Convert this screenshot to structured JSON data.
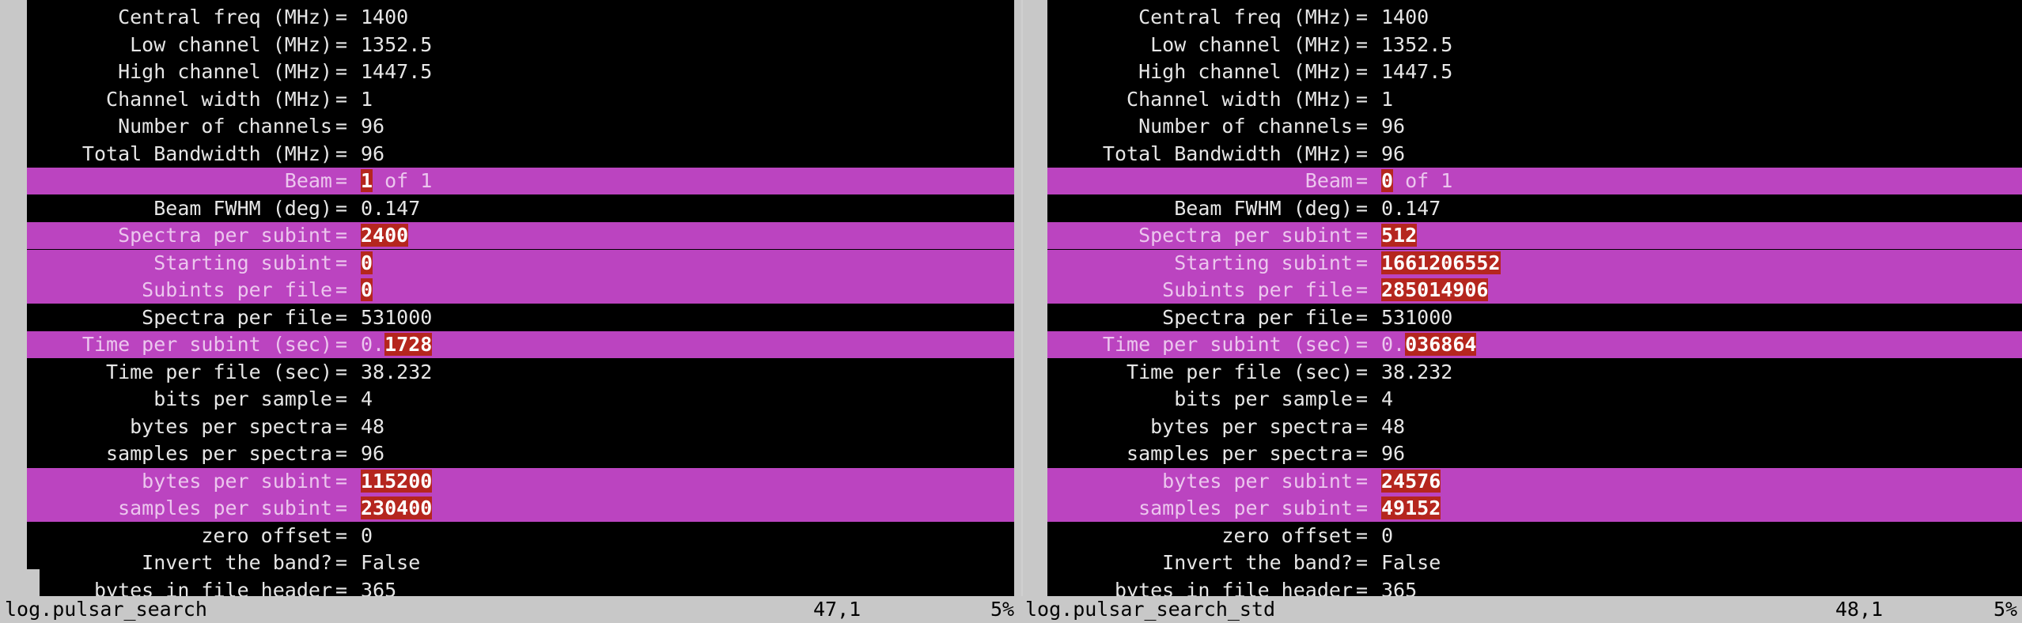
{
  "left": {
    "lines": [
      {
        "label": "Central freq (MHz)",
        "value": "1400"
      },
      {
        "label": "Low channel (MHz)",
        "value": "1352.5"
      },
      {
        "label": "High channel (MHz)",
        "value": "1447.5"
      },
      {
        "label": "Channel width (MHz)",
        "value": "1"
      },
      {
        "label": "Number of channels",
        "value": "96"
      },
      {
        "label": "Total Bandwidth (MHz)",
        "value": "96"
      },
      {
        "label": "Beam",
        "value_diff": "1",
        "value_rest": " of 1",
        "highlight": true
      },
      {
        "label": "Beam FWHM (deg)",
        "value": "0.147"
      },
      {
        "label": "Spectra per subint",
        "value_diff": "2400",
        "highlight": true
      },
      {
        "label": "Starting subint",
        "value_diff": "0",
        "highlight": true
      },
      {
        "label": "Subints per file",
        "value_diff": "0",
        "highlight": true
      },
      {
        "label": "Spectra per file",
        "value": "531000"
      },
      {
        "label": "Time per subint (sec)",
        "value_pre": "0.",
        "value_diff": "1728",
        "highlight": true
      },
      {
        "label": "Time per file (sec)",
        "value": "38.232"
      },
      {
        "label": "bits per sample",
        "value": "4"
      },
      {
        "label": "bytes per spectra",
        "value": "48"
      },
      {
        "label": "samples per spectra",
        "value": "96"
      },
      {
        "label": "bytes per subint",
        "value_diff": "115200",
        "highlight": true
      },
      {
        "label": "samples per subint",
        "value_diff": "230400",
        "highlight": true
      },
      {
        "label": "zero offset",
        "value": "0"
      },
      {
        "label": "Invert the band?",
        "value": "False"
      },
      {
        "label": "bytes in file header",
        "value": "365"
      }
    ]
  },
  "right": {
    "lines": [
      {
        "label": "Central freq (MHz)",
        "value": "1400"
      },
      {
        "label": "Low channel (MHz)",
        "value": "1352.5"
      },
      {
        "label": "High channel (MHz)",
        "value": "1447.5"
      },
      {
        "label": "Channel width (MHz)",
        "value": "1"
      },
      {
        "label": "Number of channels",
        "value": "96"
      },
      {
        "label": "Total Bandwidth (MHz)",
        "value": "96"
      },
      {
        "label": "Beam",
        "value_diff": "0",
        "value_rest": " of 1",
        "highlight": true
      },
      {
        "label": "Beam FWHM (deg)",
        "value": "0.147"
      },
      {
        "label": "Spectra per subint",
        "value_diff": "512",
        "highlight": true
      },
      {
        "label": "Starting subint",
        "value_diff": "1661206552",
        "highlight": true
      },
      {
        "label": "Subints per file",
        "value_diff": "285014906",
        "highlight": true
      },
      {
        "label": "Spectra per file",
        "value": "531000"
      },
      {
        "label": "Time per subint (sec)",
        "value_pre": "0.",
        "value_diff": "036864",
        "highlight": true
      },
      {
        "label": "Time per file (sec)",
        "value": "38.232"
      },
      {
        "label": "bits per sample",
        "value": "4"
      },
      {
        "label": "bytes per spectra",
        "value": "48"
      },
      {
        "label": "samples per spectra",
        "value": "96"
      },
      {
        "label": "bytes per subint",
        "value_diff": "24576",
        "highlight": true
      },
      {
        "label": "samples per subint",
        "value_diff": "49152",
        "highlight": true
      },
      {
        "label": "zero offset",
        "value": "0"
      },
      {
        "label": "Invert the band?",
        "value": "False"
      },
      {
        "label": "bytes in file header",
        "value": "365"
      }
    ]
  },
  "statusbar": {
    "left_file": "log.pulsar_search",
    "left_pos": "47,1",
    "left_pct": "5%",
    "right_file": "log.pulsar_search_std",
    "right_pos": "48,1",
    "right_pct": "5%"
  },
  "colors": {
    "highlight_line": "#bb44c0",
    "diff_text": "#b5261e",
    "gutter": "#c8c8c8"
  }
}
